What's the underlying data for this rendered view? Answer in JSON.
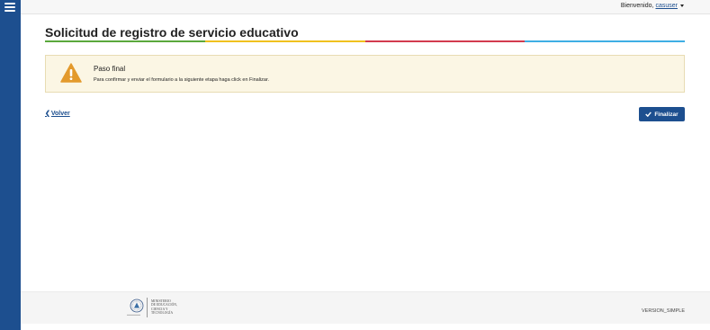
{
  "header": {
    "welcome_text": "Bienvenido,",
    "username": "casuser"
  },
  "page": {
    "title": "Solicitud de registro de servicio educativo",
    "color_stripe": [
      "#5aa83c",
      "#f0c11e",
      "#d23b4e",
      "#3eaee4"
    ]
  },
  "alert": {
    "icon": "warning-icon",
    "title": "Paso final",
    "message": "Para confirmar y enviar el formulario a la siguiente etapa haga click en Finalizar."
  },
  "actions": {
    "back_label": "Volver",
    "finish_label": "Finalizar"
  },
  "footer": {
    "ministry_lines": [
      "MINISTERIO",
      "DE EDUCACIÓN,",
      "CIENCIA Y",
      "TECNOLOGÍA"
    ],
    "version": "VERSION_SIMPLE"
  }
}
